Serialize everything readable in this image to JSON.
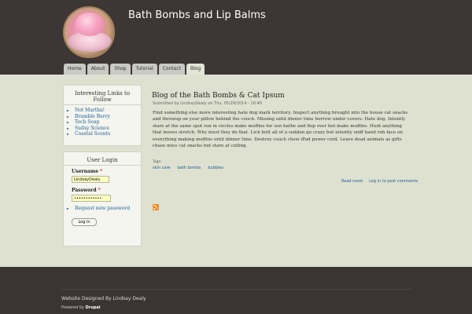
{
  "site": {
    "title": "Bath Bombs and Lip Balms"
  },
  "nav": {
    "tabs": [
      {
        "label": "Home"
      },
      {
        "label": "About"
      },
      {
        "label": "Shop"
      },
      {
        "label": "Tutorial"
      },
      {
        "label": "Contact"
      },
      {
        "label": "Blog",
        "active": true
      }
    ]
  },
  "sidebar": {
    "links_block": {
      "title": "Interesting Links to Follow",
      "items": [
        "Not Martha!",
        "Bramble Berry",
        "Tech Soap",
        "Sudsy Science",
        "Coastal Scents"
      ]
    },
    "login": {
      "title": "User Login",
      "username_label": "Username",
      "username_value": "LindsayDealy",
      "password_label": "Password",
      "password_value": "••••••••••••",
      "required_mark": "*",
      "request_password": "Request new password",
      "login_button": "Log in"
    }
  },
  "post": {
    "title": "Blog of the Bath Bombs & Cat Ipsum",
    "submitted": "Submitted by LindsayDealy on Thu, 05/29/2014 - 16:40",
    "body": "Find something else more interesting hate dog mark territory. Inspect anything brought into the house cat snacks and throwup on your pillow behind the couch. Missing until dinner time burrow under covers. Hate dog. Intently stare at the same spot run in circles make muffins for sun bathe and flop over but make muffins. Hunt anything that moves stretch. Why must they do that. Lick butt all of a sudden go crazy but intently sniff hand rub face on everything making muffins until dinner time. Destroy couch chew iPad power cord. Leave dead animals as gifts chase mice cat snacks but stare at ceiling.",
    "tags_label": "Tags:",
    "tags": [
      "skin care",
      "bath bombs",
      "bubbles"
    ],
    "read_more": "Read more",
    "login_to_comment": "Log in to post comments"
  },
  "footer": {
    "designed_by": "Website Designed By Lindsay Dealy",
    "powered_prefix": "Powered by",
    "powered_name": "Drupal"
  },
  "colors": {
    "link": "#1a5c97",
    "header_bg": "#3c3634",
    "main_bg": "#dfe1d0",
    "rss": "#f08a24"
  },
  "icons": {
    "feed": "rss-feed-icon"
  }
}
